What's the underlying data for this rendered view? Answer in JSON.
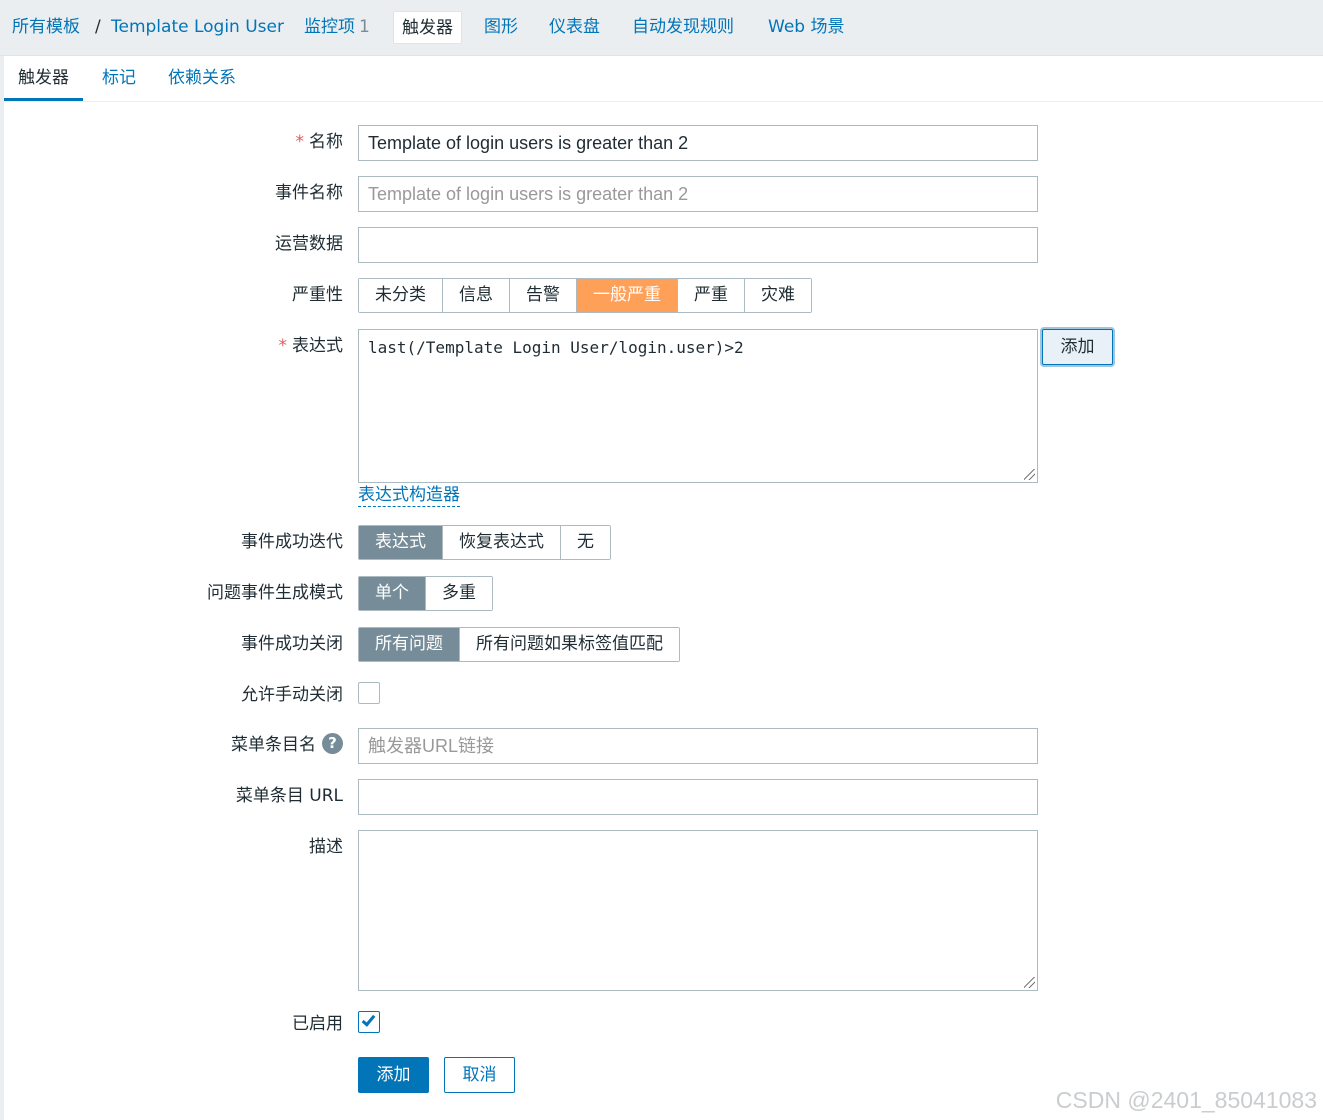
{
  "breadcrumb": {
    "all_templates": "所有模板",
    "separator": "/",
    "template_name": "Template Login User"
  },
  "topnav": {
    "items": [
      {
        "label": "监控项",
        "count": "1"
      },
      {
        "label": "触发器"
      },
      {
        "label": "图形"
      },
      {
        "label": "仪表盘"
      },
      {
        "label": "自动发现规则"
      },
      {
        "label": "Web 场景"
      }
    ]
  },
  "tabs": [
    "触发器",
    "标记",
    "依赖关系"
  ],
  "form": {
    "name": {
      "label": "名称",
      "value": "Template of login users is greater than 2"
    },
    "event_name": {
      "label": "事件名称",
      "placeholder": "Template of login users is greater than 2"
    },
    "opdata": {
      "label": "运营数据",
      "value": ""
    },
    "severity": {
      "label": "严重性",
      "options": [
        "未分类",
        "信息",
        "告警",
        "一般严重",
        "严重",
        "灾难"
      ],
      "selected": "一般严重"
    },
    "expression": {
      "label": "表达式",
      "value": "last(/Template Login User/login.user)>2",
      "add_button": "添加",
      "constructor_link": "表达式构造器"
    },
    "recovery_mode": {
      "label": "事件成功迭代",
      "options": [
        "表达式",
        "恢复表达式",
        "无"
      ],
      "selected": "表达式"
    },
    "event_mode": {
      "label": "问题事件生成模式",
      "options": [
        "单个",
        "多重"
      ],
      "selected": "单个"
    },
    "ok_close": {
      "label": "事件成功关闭",
      "options": [
        "所有问题",
        "所有问题如果标签值匹配"
      ],
      "selected": "所有问题"
    },
    "manual_close": {
      "label": "允许手动关闭",
      "checked": false
    },
    "url_name": {
      "label": "菜单条目名",
      "placeholder": "触发器URL链接"
    },
    "url": {
      "label": "菜单条目 URL",
      "value": ""
    },
    "description": {
      "label": "描述",
      "value": ""
    },
    "enabled": {
      "label": "已启用",
      "checked": true
    },
    "submit": "添加",
    "cancel": "取消"
  },
  "watermark": "CSDN @2401_85041083",
  "colors": {
    "accent": "#0275b8",
    "severity_average": "#ffa059",
    "selected_segment": "#768d99"
  }
}
